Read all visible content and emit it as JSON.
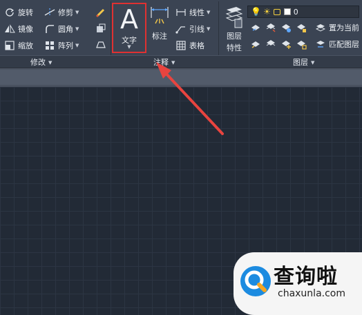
{
  "modify_panel": {
    "rotate": "旋转",
    "trim": "修剪",
    "mirror": "镜像",
    "fillet": "圆角",
    "scale": "缩放",
    "array": "阵列",
    "label": "修改"
  },
  "annotation_panel": {
    "text_glyph": "A",
    "text": "文字",
    "dimension": "标注",
    "linear": "线性",
    "leader": "引线",
    "table": "表格",
    "label": "注释"
  },
  "layers_panel": {
    "layer_properties_line1": "图层",
    "layer_properties_line2": "特性",
    "current_layer": "0",
    "set_current": "置为当前",
    "match_layer": "匹配图层",
    "label": "图层"
  },
  "watermark": {
    "main": "查询啦",
    "sub": "chaxunla.com"
  },
  "colors": {
    "highlight_border": "#e03131",
    "arrow": "#e8443f",
    "ribbon_bg": "#3b4453",
    "canvas_bg": "#222a36"
  }
}
